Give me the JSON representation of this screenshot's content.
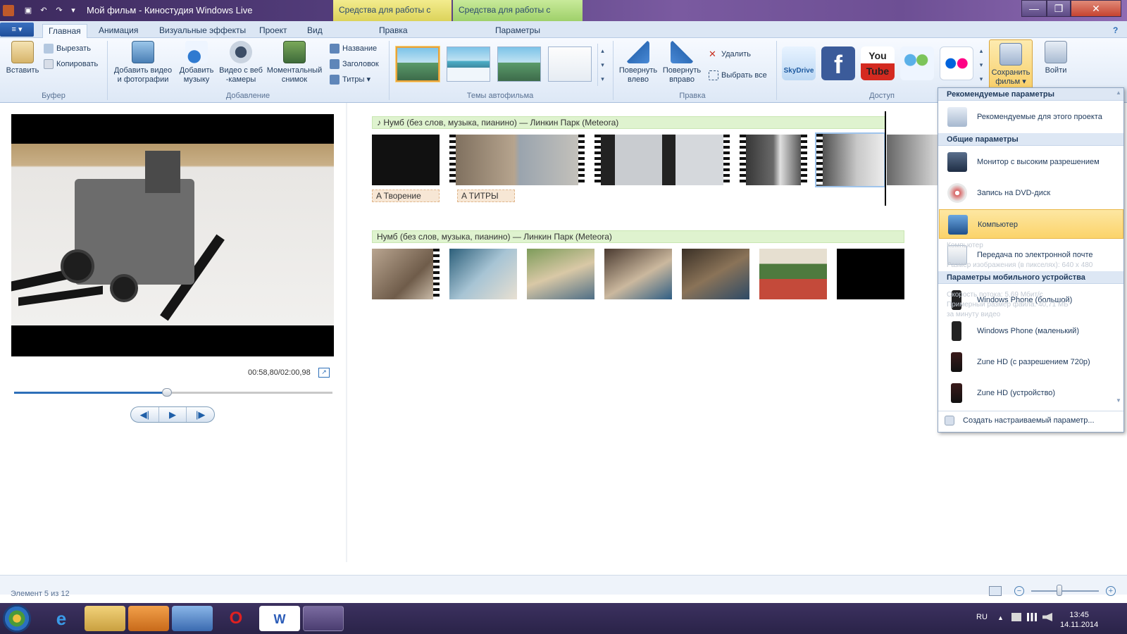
{
  "window": {
    "title": "Мой фильм - Киностудия Windows Live",
    "contextual_tabs": {
      "video_tools": "Средства для работы с видео",
      "music_tools": "Средства для работы с музыкой"
    },
    "minimize": "—",
    "maximize": "❐",
    "close": "✕"
  },
  "ribbon": {
    "file_menu_label": "≡ ▾",
    "help": "?",
    "tabs": [
      "Главная",
      "Анимация",
      "Визуальные эффекты",
      "Проект",
      "Вид",
      "Правка",
      "Параметры"
    ],
    "active_tab": "Главная",
    "clipboard": {
      "paste": "Вставить",
      "cut": "Вырезать",
      "copy": "Копировать",
      "group": "Буфер"
    },
    "add": {
      "add_videos": "Добавить видео и фотографии",
      "add_music": "Добавить музыку",
      "webcam": "Видео с веб -камеры",
      "snapshot": "Моментальный снимок",
      "title": "Название",
      "caption": "Заголовок",
      "credits": "Титры",
      "group": "Добавление"
    },
    "themes_group": "Темы автофильма",
    "edit": {
      "rotate_left": "Повернуть влево",
      "rotate_right": "Повернуть вправо",
      "delete": "Удалить",
      "select_all": "Выбрать все",
      "group": "Правка"
    },
    "share": {
      "skydrive": "SkyDrive",
      "youtube": "You Tube",
      "facebook": "f",
      "group": "Доступ"
    },
    "save_movie": "Сохранить фильм",
    "sign_in": "Войти"
  },
  "preview": {
    "timecode": "00:58,80/02:00,98",
    "position": 0.48
  },
  "controls": {
    "prev_frame": "◀|",
    "play": "▶",
    "next_frame": "|▶"
  },
  "storyboard": {
    "music_track_1": "♪ Нумб (без слов, музыка, пианино) — Линкин Парк (Meteora)",
    "music_track_2": "Нумб (без слов, музыка, пианино) — Линкин Парк (Meteora)",
    "captions": [
      "A Творение",
      "A ТИТРЫ"
    ]
  },
  "save_menu": {
    "headers": [
      "Рекомендуемые параметры",
      "Общие параметры",
      "Параметры мобильного устройства"
    ],
    "items": [
      "Рекомендуемые для этого проекта",
      "Монитор с высоким разрешением",
      "Запись на DVD-диск",
      "Компьютер",
      "Передача по электронной почте",
      "Windows Phone (большой)",
      "Windows Phone (маленький)",
      "Zune HD (с разрешением 720p)",
      "Zune HD (устройство)"
    ],
    "custom": "Создать настраиваемый параметр...",
    "tooltip_ghost": [
      "Компьютер",
      "Размер изображения (в пикселях): 640 x 480",
      "Скорость потока: 5,69 Мбит/с",
      "Примерный размер файла: 40,71 МБ",
      "за минуту видео"
    ]
  },
  "status": {
    "text": "Элемент 5 из 12"
  },
  "taskbar": {
    "language": "RU",
    "time": "13:45",
    "date": "14.11.2014",
    "opera": "O",
    "word": "W",
    "ie": "e"
  },
  "colors": {
    "accent": "#2d6fb8",
    "highlight": "#fbd36a",
    "music_bar": "#dff3cf"
  }
}
